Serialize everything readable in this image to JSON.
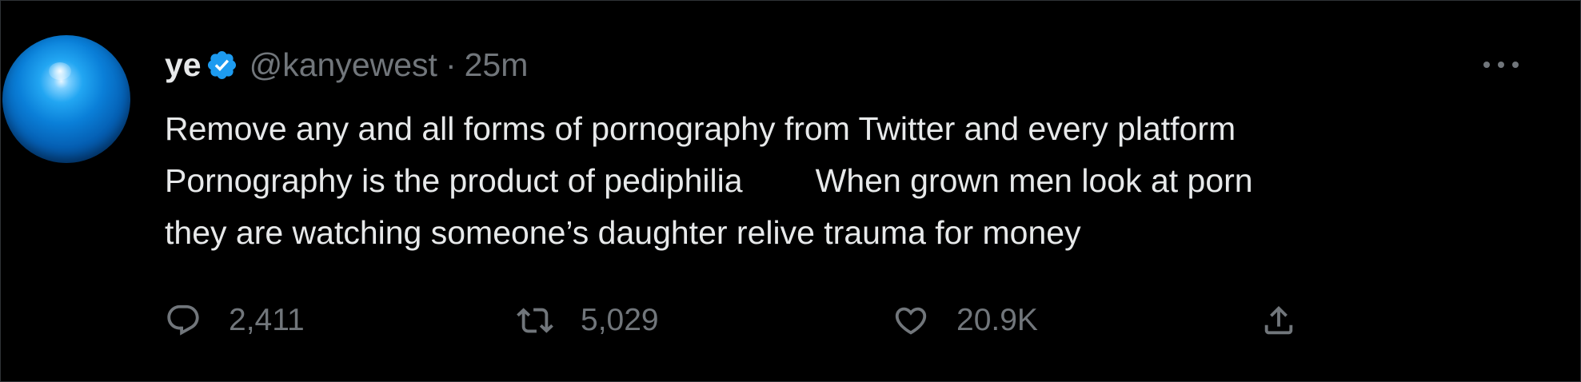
{
  "tweet": {
    "author": {
      "display_name": "ye",
      "handle": "@kanyewest",
      "verified": true,
      "verified_badge_color": "#1d9bf0"
    },
    "separator": "·",
    "timestamp": "25m",
    "text_lines": [
      "Remove any and all forms of pornography from Twitter and every platform",
      "Pornography is the product of pediphilia        When grown men look at porn",
      "they are watching someone’s daughter relive trauma for money"
    ],
    "more_icon": "more-horizontal-icon",
    "actions": {
      "reply": {
        "icon": "reply-icon",
        "count": "2,411"
      },
      "retweet": {
        "icon": "retweet-icon",
        "count": "5,029"
      },
      "like": {
        "icon": "heart-icon",
        "count": "20.9K"
      },
      "share": {
        "icon": "share-icon"
      }
    }
  },
  "colors": {
    "background": "#000000",
    "primary_text": "#e7e9ea",
    "secondary_text": "#71767b",
    "accent": "#1d9bf0"
  }
}
